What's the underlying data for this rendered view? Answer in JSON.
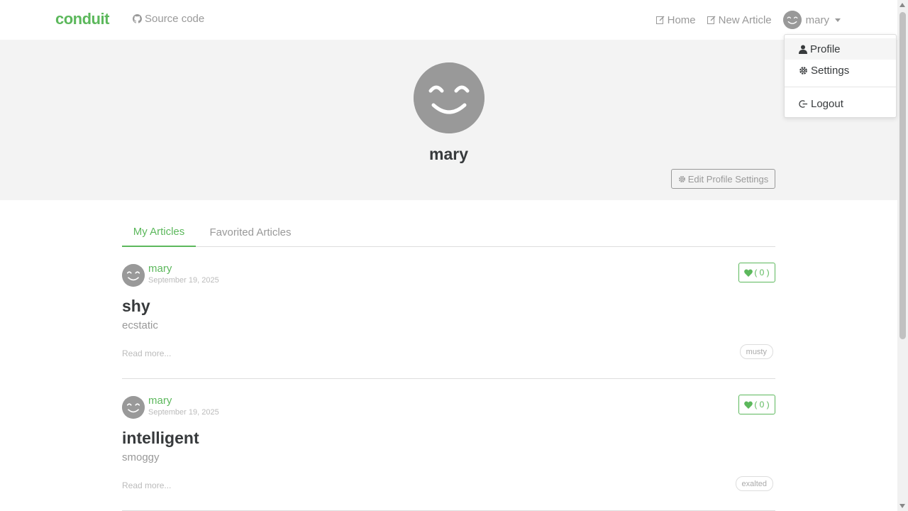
{
  "brand": "conduit",
  "nav": {
    "source_code": "Source code",
    "home": "Home",
    "new_article": "New Article",
    "user": "mary"
  },
  "dropdown": {
    "profile": "Profile",
    "settings": "Settings",
    "logout": "Logout"
  },
  "profile": {
    "username": "mary",
    "edit_button": "Edit Profile Settings"
  },
  "tabs": [
    "My Articles",
    "Favorited Articles"
  ],
  "articles": [
    {
      "author": "mary",
      "date": "September 19, 2025",
      "favorites": "( 0 )",
      "title": "shy",
      "description": "ecstatic",
      "read_more": "Read more...",
      "tag": "musty"
    },
    {
      "author": "mary",
      "date": "September 19, 2025",
      "favorites": "( 0 )",
      "title": "intelligent",
      "description": "smoggy",
      "read_more": "Read more...",
      "tag": "exalted"
    }
  ],
  "colors": {
    "accent": "#5cb85c",
    "muted": "#999999",
    "banner": "#f3f3f3"
  }
}
